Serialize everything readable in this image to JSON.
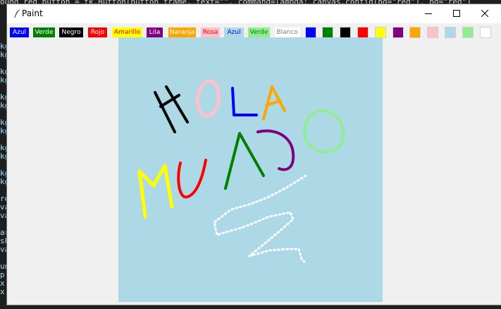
{
  "window": {
    "title": "Paint"
  },
  "background_code": {
    "top_line": "ound_red_button = tk.Button(button_frame, text=\"\", command=lambda: canvas.config(bg=\"red\"), bg=\"red\")",
    "left_fragments": [
      "kg",
      "kg",
      "",
      "kg",
      "kg",
      "",
      "kg",
      "kg",
      "",
      "kg",
      "kg",
      "",
      "kg",
      "kg",
      "",
      "kg",
      "kg",
      "",
      "re",
      "va",
      "va",
      "",
      "ar",
      "sh",
      "va",
      "",
      "un",
      "p",
      "x",
      "x"
    ]
  },
  "toolbar": {
    "buttons": [
      {
        "label": "Azul",
        "bg": "#0000ff",
        "fg": "#ffffff"
      },
      {
        "label": "Verde",
        "bg": "#008000",
        "fg": "#ffffff"
      },
      {
        "label": "Negro",
        "bg": "#000000",
        "fg": "#ffffff"
      },
      {
        "label": "Rojo",
        "bg": "#ff0000",
        "fg": "#ffffff"
      },
      {
        "label": "Amarillo",
        "bg": "#ffff00",
        "fg": "#ff0000"
      },
      {
        "label": "Lila",
        "bg": "#800080",
        "fg": "#ffffff"
      },
      {
        "label": "Naranja",
        "bg": "#ffa500",
        "fg": "#ffffff"
      },
      {
        "label": "Rosa",
        "bg": "#ffc0cb",
        "fg": "#ff0000"
      },
      {
        "label": "Azul",
        "bg": "#add8e6",
        "fg": "#0000ff"
      },
      {
        "label": "Verde",
        "bg": "#90ee90",
        "fg": "#008000"
      },
      {
        "label": "Blanco",
        "bg": "#ffffff",
        "fg": "#808080"
      }
    ],
    "swatches": [
      {
        "name": "blue",
        "color": "#0000ff"
      },
      {
        "name": "green",
        "color": "#008000"
      },
      {
        "name": "black",
        "color": "#000000"
      },
      {
        "name": "red",
        "color": "#ff0000"
      },
      {
        "name": "yellow",
        "color": "#ffff00"
      },
      {
        "name": "purple",
        "color": "#800080"
      },
      {
        "name": "orange",
        "color": "#ffa500"
      },
      {
        "name": "pink",
        "color": "#ffc0cb"
      },
      {
        "name": "lightblue",
        "color": "#add8e6"
      },
      {
        "name": "lightgreen",
        "color": "#90ee90"
      },
      {
        "name": "white",
        "color": "#ffffff"
      }
    ]
  },
  "canvas": {
    "background": "#add8e6",
    "drawing_words": [
      "HOLA",
      "MUNDO"
    ]
  }
}
